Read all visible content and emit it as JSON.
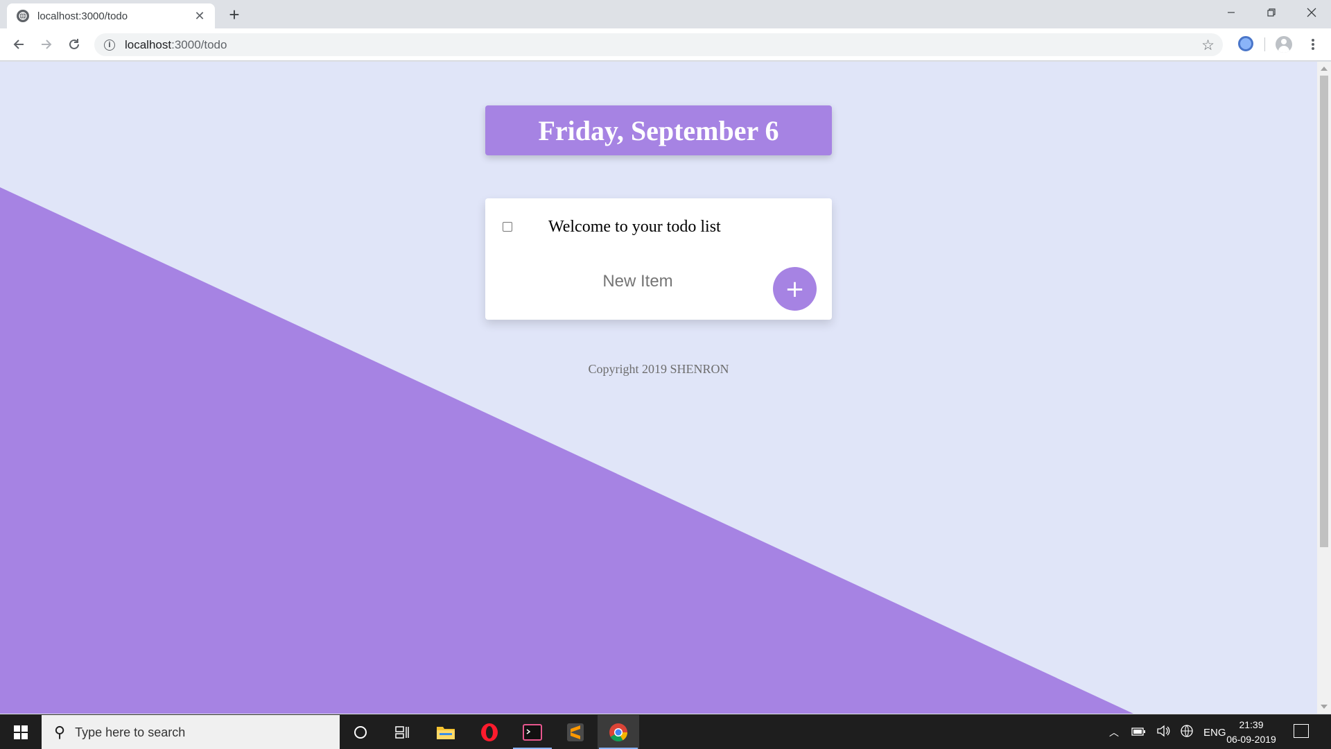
{
  "browser": {
    "tab_title": "localhost:3000/todo",
    "tab_close": "✕",
    "new_tab": "+",
    "url_host": "localhost",
    "url_rest": ":3000/todo",
    "window_controls": {
      "minimize": "—",
      "restore": "❐",
      "close": "✕"
    }
  },
  "page": {
    "heading": "Friday, September 6",
    "items": [
      {
        "text": "Welcome to your todo list",
        "checked": false
      }
    ],
    "new_item_placeholder": "New Item",
    "add_button_label": "+",
    "footer": "Copyright 2019 SHENRON",
    "colors": {
      "accent": "#a683e3",
      "background": "#e0e5f8"
    }
  },
  "taskbar": {
    "search_placeholder": "Type here to search",
    "apps": [
      "cortana-icon",
      "task-view-icon",
      "file-explorer-icon",
      "opera-icon",
      "terminal-icon",
      "sublime-text-icon",
      "chrome-icon"
    ],
    "tray": {
      "language": "ENG",
      "time": "21:39",
      "date": "06-09-2019"
    }
  }
}
